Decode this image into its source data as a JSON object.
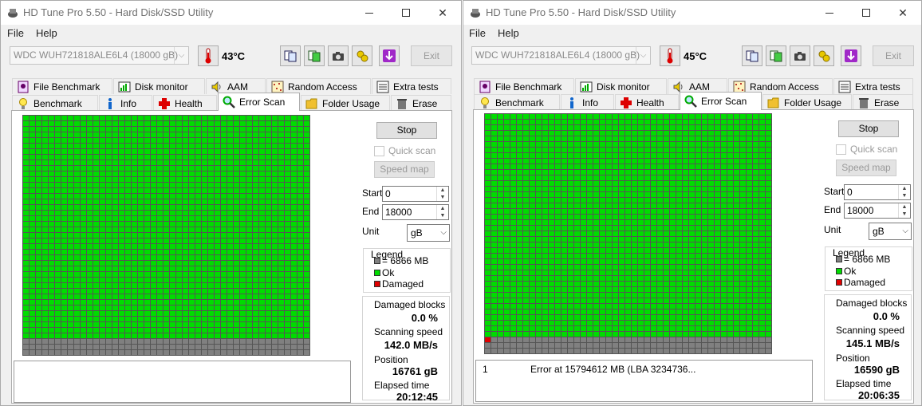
{
  "colors": {
    "ok": "#00dc00",
    "pending": "#808080",
    "damaged": "#e00000"
  },
  "windows": [
    {
      "title": "HD Tune Pro 5.50 - Hard Disk/SSD Utility",
      "menu": [
        "File",
        "Help"
      ],
      "drive": "WDC  WUH721818ALE6L4 (18000 gB)",
      "temperature": "43°C",
      "exit_label": "Exit",
      "tabs_row1": [
        "File Benchmark",
        "Disk monitor",
        "AAM",
        "Random Access",
        "Extra tests"
      ],
      "tabs_row2": [
        "Benchmark",
        "Info",
        "Health",
        "Error Scan",
        "Folder Usage",
        "Erase"
      ],
      "active_tab": "Error Scan",
      "stop_label": "Stop",
      "quick_scan_label": "Quick scan",
      "speed_map_label": "Speed map",
      "start_label": "Start",
      "start_value": "0",
      "end_label": "End",
      "end_value": "18000",
      "unit_label": "Unit",
      "unit_value": "gB",
      "legend": {
        "title": "Legend",
        "block": "= 6866 MB",
        "ok": "Ok",
        "damaged": "Damaged"
      },
      "damaged_blocks_label": "Damaged blocks",
      "damaged_blocks_value": "0.0 %",
      "scanning_speed_label": "Scanning speed",
      "scanning_speed_value": "142.0 MB/s",
      "position_label": "Position",
      "position_value": "16761 gB",
      "elapsed_label": "Elapsed time",
      "elapsed_value": "20:12:45",
      "log_entries": [],
      "grid": {
        "columns": 45,
        "rows": 43,
        "ok_rows": 40,
        "damaged_cells": 0
      }
    },
    {
      "title": "HD Tune Pro 5.50 - Hard Disk/SSD Utility",
      "menu": [
        "File",
        "Help"
      ],
      "drive": "WDC  WUH721818ALE6L4 (18000 gB)",
      "temperature": "45°C",
      "exit_label": "Exit",
      "tabs_row1": [
        "File Benchmark",
        "Disk monitor",
        "AAM",
        "Random Access",
        "Extra tests"
      ],
      "tabs_row2": [
        "Benchmark",
        "Info",
        "Health",
        "Error Scan",
        "Folder Usage",
        "Erase"
      ],
      "active_tab": "Error Scan",
      "stop_label": "Stop",
      "quick_scan_label": "Quick scan",
      "speed_map_label": "Speed map",
      "start_label": "Start",
      "start_value": "0",
      "end_label": "End",
      "end_value": "18000",
      "unit_label": "Unit",
      "unit_value": "gB",
      "legend": {
        "title": "Legend",
        "block": "= 6866 MB",
        "ok": "Ok",
        "damaged": "Damaged"
      },
      "damaged_blocks_label": "Damaged blocks",
      "damaged_blocks_value": "0.0 %",
      "scanning_speed_label": "Scanning speed",
      "scanning_speed_value": "145.1 MB/s",
      "position_label": "Position",
      "position_value": "16590 gB",
      "elapsed_label": "Elapsed time",
      "elapsed_value": "20:06:35",
      "log_entries": [
        {
          "index": "1",
          "text": "Error at 15794612 MB (LBA 3234736..."
        }
      ],
      "grid": {
        "columns": 45,
        "rows": 43,
        "ok_rows": 40,
        "damaged_cells": 1
      }
    }
  ]
}
